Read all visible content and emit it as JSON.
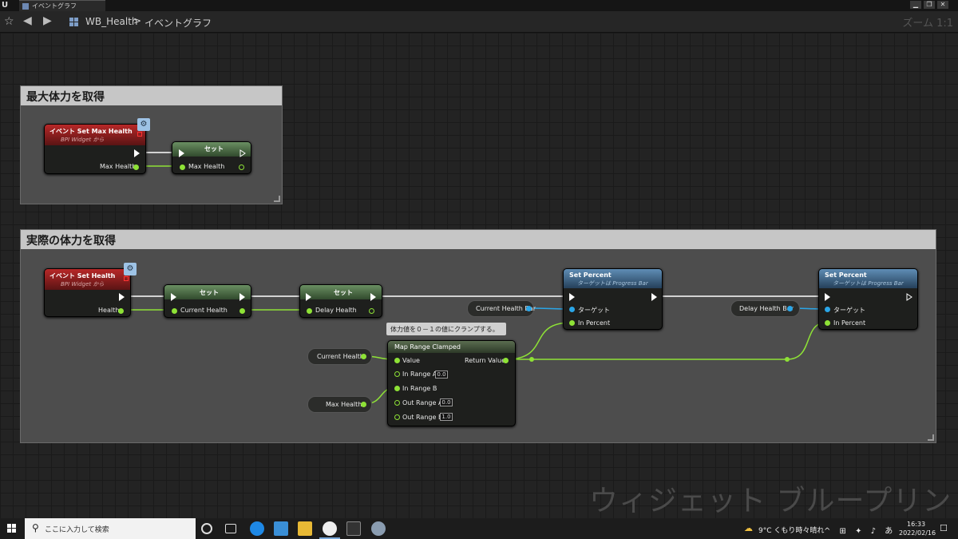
{
  "window": {
    "tab_label": "イベントグラフ",
    "minimize": "▁",
    "restore": "❐",
    "close": "✕"
  },
  "toolbar": {
    "breadcrumb_root": "WB_Health",
    "breadcrumb_sep": ">",
    "breadcrumb_leaf": "イベントグラフ",
    "zoom": "ズーム 1:1"
  },
  "comments": [
    {
      "title": "最大体力を取得"
    },
    {
      "title": "実際の体力を取得"
    }
  ],
  "nodes": {
    "event_set_max_health": {
      "title": "イベント Set Max Health",
      "subtitle": "BPI Widget から",
      "pin": "Max Health"
    },
    "set_max": {
      "title": "セット",
      "pin": "Max Health"
    },
    "event_set_health": {
      "title": "イベント Set Health",
      "subtitle": "BPI Widget から",
      "pin": "Health"
    },
    "set_current": {
      "title": "セット",
      "pin": "Current Health"
    },
    "set_delay": {
      "title": "セット",
      "pin": "Delay Health"
    },
    "set_percent_1": {
      "title": "Set Percent",
      "subtitle": "ターゲットは Progress Bar",
      "pin_target": "ターゲット",
      "pin_percent": "In Percent"
    },
    "set_percent_2": {
      "title": "Set Percent",
      "subtitle": "ターゲットは Progress Bar",
      "pin_target": "ターゲット",
      "pin_percent": "In Percent"
    },
    "map_range": {
      "title": "Map Range Clamped",
      "comment": "体力値を０－１の値にクランプする。",
      "pins": [
        "Value",
        "In Range A",
        "In Range B",
        "Out Range A",
        "Out Range B"
      ],
      "in_range_a": "0.0",
      "out_range_a": "0.0",
      "out_range_b": "1.0",
      "output": "Return Value"
    }
  },
  "variables": {
    "current_health_bar": "Current Health Bar",
    "delay_health_bar": "Delay Health Bar",
    "current_health": "Current Health",
    "max_health": "Max Health"
  },
  "watermark": "ウィジェット ブループリント",
  "taskbar": {
    "search_placeholder": "ここに入力して検索",
    "weather": "9°C くもり時々晴れ",
    "tray": "^ ⊞ ✦ ♪ あ",
    "time": "16:33",
    "date": "2022/02/16"
  },
  "colors": {
    "float_pin": "#8ee236",
    "object_pin": "#2aa6e8",
    "event_header": "#b82828",
    "function_header": "#5f8db5"
  }
}
